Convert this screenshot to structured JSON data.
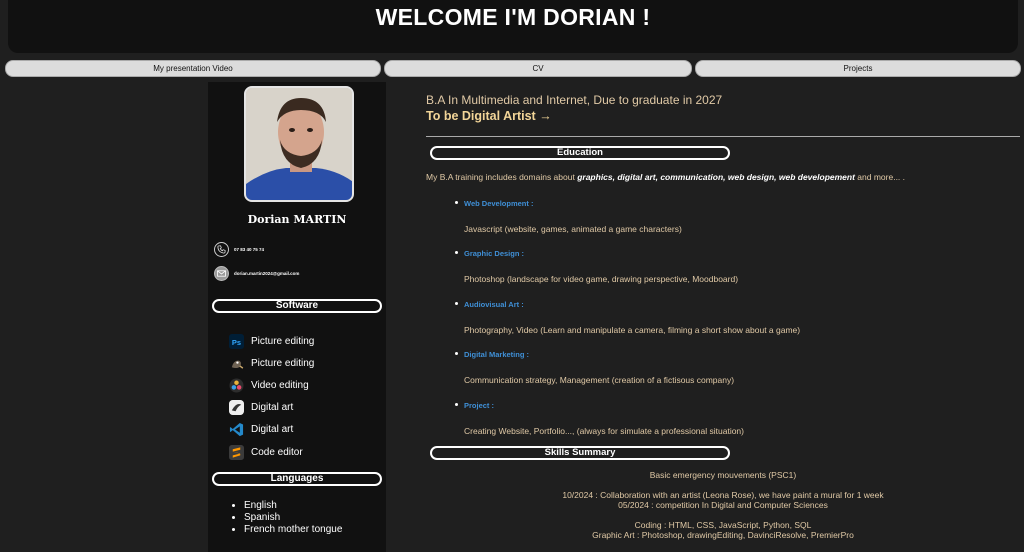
{
  "header": {
    "title": "WELCOME I'M DORIAN !"
  },
  "nav": [
    {
      "label": "My presentation Video"
    },
    {
      "label": "CV"
    },
    {
      "label": "Projects"
    }
  ],
  "sidebar": {
    "name": "Dorian MARTIN",
    "phone": "07 83 40 75 74",
    "email": "dorian.martin2024@gmail.com",
    "software_title": "Software",
    "software": [
      {
        "icon": "photoshop-icon",
        "label": "Picture editing"
      },
      {
        "icon": "gimp-icon",
        "label": "Picture editing"
      },
      {
        "icon": "davinci-resolve-icon",
        "label": "Video editing"
      },
      {
        "icon": "clip-studio-icon",
        "label": "Digital art"
      },
      {
        "icon": "vscode-icon",
        "label": "Digital art"
      },
      {
        "icon": "sublime-text-icon",
        "label": "Code editor"
      }
    ],
    "languages_title": "Languages",
    "languages": [
      "English",
      "Spanish",
      "French mother tongue"
    ]
  },
  "main": {
    "degree": "B.A In Multimedia and Internet, Due to graduate in 2027",
    "goal": "To be Digital Artist →",
    "education_title": "Education",
    "intro_prefix": "My B.A training includes domains about ",
    "intro_bold": "graphics, digital art, communication, web design, web developement",
    "intro_suffix": " and more... .",
    "education": [
      {
        "title": "Web Development :",
        "desc": "Javascript (website, games, animated a game characters)"
      },
      {
        "title": "Graphic Design :",
        "desc": "Photoshop (landscape for video game, drawing perspective, Moodboard)"
      },
      {
        "title": "Audiovisual Art :",
        "desc": "Photography, Video (Learn and manipulate a camera, filming a short show about a game)"
      },
      {
        "title": "Digital Marketing :",
        "desc": "Communication strategy, Management (creation of a fictisous company)"
      },
      {
        "title": "Project :",
        "desc": "Creating Website, Portfolio..., (always for simulate a professional situation)"
      }
    ],
    "skills_title": "Skills Summary",
    "skills": {
      "first_aid": "Basic emergency mouvements (PSC1)",
      "exp1": "10/2024 : Collaboration with an artist (Leona Rose), we have paint a mural for 1 week",
      "exp2": "05/2024 : competition In Digital and Computer Sciences",
      "coding": "Coding : HTML, CSS, JavaScript, Python, SQL",
      "graphic": "Graphic Art : Photoshop, drawingEditing, DavinciResolve, PremierPro"
    }
  }
}
